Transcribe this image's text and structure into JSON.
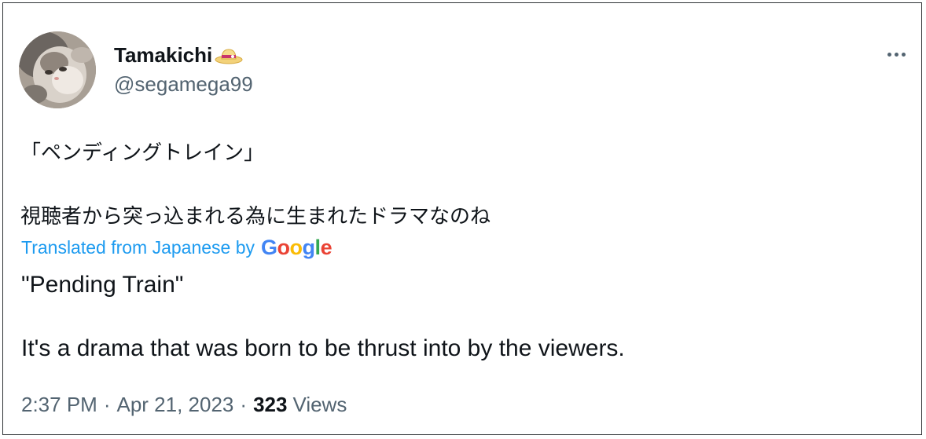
{
  "author": {
    "display_name": "Tamakichi",
    "handle": "@segamega99",
    "badge_icon": "straw-hat-icon"
  },
  "more_icon": "more-options-icon",
  "tweet": {
    "original_lines": [
      "「ペンディングトレイン」",
      "視聴者から突っ込まれる為に生まれたドラマなのね"
    ],
    "translated_label": "Translated from Japanese by",
    "translation_provider": "Google",
    "translation_lines": [
      "\"Pending Train\"",
      "It's a drama that was born to be thrust into by the viewers."
    ]
  },
  "meta": {
    "time": "2:37 PM",
    "separator": "·",
    "date": "Apr 21, 2023",
    "views_count": "323",
    "views_label": "Views"
  },
  "colors": {
    "text_primary": "#0f1419",
    "text_secondary": "#536471",
    "link": "#1d9bf0"
  }
}
